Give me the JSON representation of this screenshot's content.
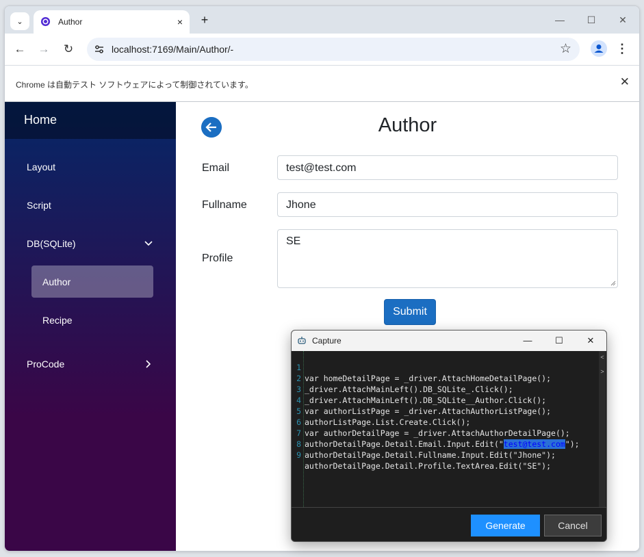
{
  "browser": {
    "tab_title": "Author",
    "url": "localhost:7169/Main/Author/-",
    "infobar_text": "Chrome は自動テスト ソフトウェアによって制御されています。",
    "new_tab_label": "+",
    "tab_close_label": "×",
    "infobar_close_label": "✕",
    "minimize_label": "—",
    "maximize_label": "☐",
    "close_label": "✕",
    "back_label": "←",
    "forward_label": "→",
    "reload_label": "↻",
    "star_label": "☆",
    "menu_label": "⋮",
    "tab_search_label": "⌄"
  },
  "sidebar": {
    "home": "Home",
    "items": [
      {
        "label": "Layout"
      },
      {
        "label": "Script"
      },
      {
        "label": "DB(SQLite)"
      },
      {
        "label": "Author"
      },
      {
        "label": "Recipe"
      },
      {
        "label": "ProCode"
      }
    ]
  },
  "main": {
    "title": "Author",
    "email_label": "Email",
    "email_value": "test@test.com",
    "fullname_label": "Fullname",
    "fullname_value": "Jhone",
    "profile_label": "Profile",
    "profile_value": "SE",
    "submit_label": "Submit"
  },
  "capture": {
    "title": "Capture",
    "minimize_label": "—",
    "maximize_label": "☐",
    "close_label": "✕",
    "lines": [
      {
        "n": "1",
        "text": "var homeDetailPage = _driver.AttachHomeDetailPage();"
      },
      {
        "n": "2",
        "text": "_driver.AttachMainLeft().DB_SQLite_.Click();"
      },
      {
        "n": "3",
        "text": "_driver.AttachMainLeft().DB_SQLite__Author.Click();"
      },
      {
        "n": "4",
        "text": "var authorListPage = _driver.AttachAuthorListPage();"
      },
      {
        "n": "5",
        "text": "authorListPage.List.Create.Click();"
      },
      {
        "n": "6",
        "text": "var authorDetailPage = _driver.AttachAuthorDetailPage();"
      },
      {
        "n": "7",
        "text_before": "authorDetailPage.Detail.Email.Input.Edit(\"",
        "text_highlight": "test@test.com",
        "text_after": "\");"
      },
      {
        "n": "8",
        "text": "authorDetailPage.Detail.Fullname.Input.Edit(\"Jhone\");"
      },
      {
        "n": "9",
        "text": "authorDetailPage.Detail.Profile.TextArea.Edit(\"SE\");"
      }
    ],
    "scroll_up_label": "<",
    "scroll_down_label": ">",
    "generate_label": "Generate",
    "cancel_label": "Cancel"
  }
}
